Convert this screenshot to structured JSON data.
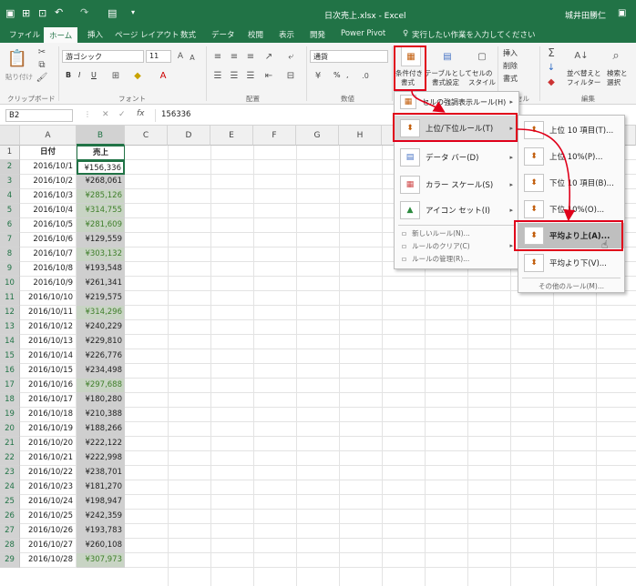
{
  "titlebar": {
    "title": "日次売上.xlsx - Excel",
    "user": "城井田勝仁",
    "undo_icon": "undo-icon",
    "redo_icon": "redo-icon"
  },
  "tabs": [
    "ファイル",
    "ホーム",
    "挿入",
    "ページ レイアウト",
    "数式",
    "データ",
    "校閲",
    "表示",
    "開発",
    "Power Pivot"
  ],
  "tell_me": "実行したい作業を入力してください",
  "ribbon": {
    "paste_label": "貼り付け",
    "clipboard_label": "クリップボード",
    "font_name": "游ゴシック",
    "font_size": "11",
    "font_group_label": "フォント",
    "bold": "B",
    "italic": "I",
    "underline": "U",
    "align_group_label": "配置",
    "number_format": "通貨",
    "number_group_label": "数値",
    "cond_format_label": "条件付き",
    "cond_format_label2": "書式",
    "table_format_label": "テーブルとして",
    "table_format_label2": "書式設定",
    "cell_style_label": "セルの",
    "cell_style_label2": "スタイル",
    "insert_label": "挿入",
    "delete_label": "削除",
    "format_label": "書式",
    "cells_group_label": "セル",
    "sort_label": "並べ替えと",
    "sort_label2": "フィルター",
    "find_label": "検索と",
    "find_label2": "選択",
    "edit_group_label": "編集",
    "percent": "%",
    "comma": ","
  },
  "formula_bar": {
    "name_box": "B2",
    "fx": "fx",
    "value": "156336"
  },
  "columns": [
    "A",
    "B",
    "C",
    "D",
    "E",
    "F",
    "G",
    "H"
  ],
  "header_row": {
    "a": "日付",
    "b": "売上"
  },
  "rows": [
    {
      "n": "1"
    },
    {
      "n": "2",
      "date": "2016/10/1",
      "sales": "¥156,336",
      "hi": false
    },
    {
      "n": "3",
      "date": "2016/10/2",
      "sales": "¥268,061",
      "hi": false
    },
    {
      "n": "4",
      "date": "2016/10/3",
      "sales": "¥285,126",
      "hi": true
    },
    {
      "n": "5",
      "date": "2016/10/4",
      "sales": "¥314,755",
      "hi": true
    },
    {
      "n": "6",
      "date": "2016/10/5",
      "sales": "¥281,609",
      "hi": true
    },
    {
      "n": "7",
      "date": "2016/10/6",
      "sales": "¥129,559",
      "hi": false
    },
    {
      "n": "8",
      "date": "2016/10/7",
      "sales": "¥303,132",
      "hi": true
    },
    {
      "n": "9",
      "date": "2016/10/8",
      "sales": "¥193,548",
      "hi": false
    },
    {
      "n": "10",
      "date": "2016/10/9",
      "sales": "¥261,341",
      "hi": false
    },
    {
      "n": "11",
      "date": "2016/10/10",
      "sales": "¥219,575",
      "hi": false
    },
    {
      "n": "12",
      "date": "2016/10/11",
      "sales": "¥314,296",
      "hi": true
    },
    {
      "n": "13",
      "date": "2016/10/12",
      "sales": "¥240,229",
      "hi": false
    },
    {
      "n": "14",
      "date": "2016/10/13",
      "sales": "¥229,810",
      "hi": false
    },
    {
      "n": "15",
      "date": "2016/10/14",
      "sales": "¥226,776",
      "hi": false
    },
    {
      "n": "16",
      "date": "2016/10/15",
      "sales": "¥234,498",
      "hi": false
    },
    {
      "n": "17",
      "date": "2016/10/16",
      "sales": "¥297,688",
      "hi": true
    },
    {
      "n": "18",
      "date": "2016/10/17",
      "sales": "¥180,280",
      "hi": false
    },
    {
      "n": "19",
      "date": "2016/10/18",
      "sales": "¥210,388",
      "hi": false
    },
    {
      "n": "20",
      "date": "2016/10/19",
      "sales": "¥188,266",
      "hi": false
    },
    {
      "n": "21",
      "date": "2016/10/20",
      "sales": "¥222,122",
      "hi": false
    },
    {
      "n": "22",
      "date": "2016/10/21",
      "sales": "¥222,998",
      "hi": false
    },
    {
      "n": "23",
      "date": "2016/10/22",
      "sales": "¥238,701",
      "hi": false
    },
    {
      "n": "24",
      "date": "2016/10/23",
      "sales": "¥181,270",
      "hi": false
    },
    {
      "n": "25",
      "date": "2016/10/24",
      "sales": "¥198,947",
      "hi": false
    },
    {
      "n": "26",
      "date": "2016/10/25",
      "sales": "¥242,359",
      "hi": false
    },
    {
      "n": "27",
      "date": "2016/10/26",
      "sales": "¥193,783",
      "hi": false
    },
    {
      "n": "28",
      "date": "2016/10/27",
      "sales": "¥260,108",
      "hi": false
    },
    {
      "n": "29",
      "date": "2016/10/28",
      "sales": "¥307,973",
      "hi": true
    }
  ],
  "menu1": {
    "items": [
      {
        "label": "セルの強調表示ルール(H)",
        "icon": "highlight-rules-icon"
      },
      {
        "label": "上位/下位ルール(T)",
        "icon": "top-bottom-rules-icon"
      },
      {
        "label": "データ バー(D)",
        "icon": "data-bar-icon"
      },
      {
        "label": "カラー スケール(S)",
        "icon": "color-scale-icon"
      },
      {
        "label": "アイコン セット(I)",
        "icon": "icon-set-icon"
      }
    ],
    "small": [
      {
        "label": "新しいルール(N)..."
      },
      {
        "label": "ルールのクリア(C)"
      },
      {
        "label": "ルールの管理(R)..."
      }
    ]
  },
  "menu2": {
    "items": [
      {
        "label": "上位 10 項目(T)..."
      },
      {
        "label": "上位 10%(P)..."
      },
      {
        "label": "下位 10 項目(B)..."
      },
      {
        "label": "下位 10%(O)..."
      },
      {
        "label": "平均より上(A)..."
      },
      {
        "label": "平均より下(V)..."
      }
    ],
    "more": "その他のルール(M)..."
  },
  "colors": {
    "excel_green": "#217346",
    "highlight_text": "#3f7f2a",
    "red_annotation": "#e0001a"
  }
}
